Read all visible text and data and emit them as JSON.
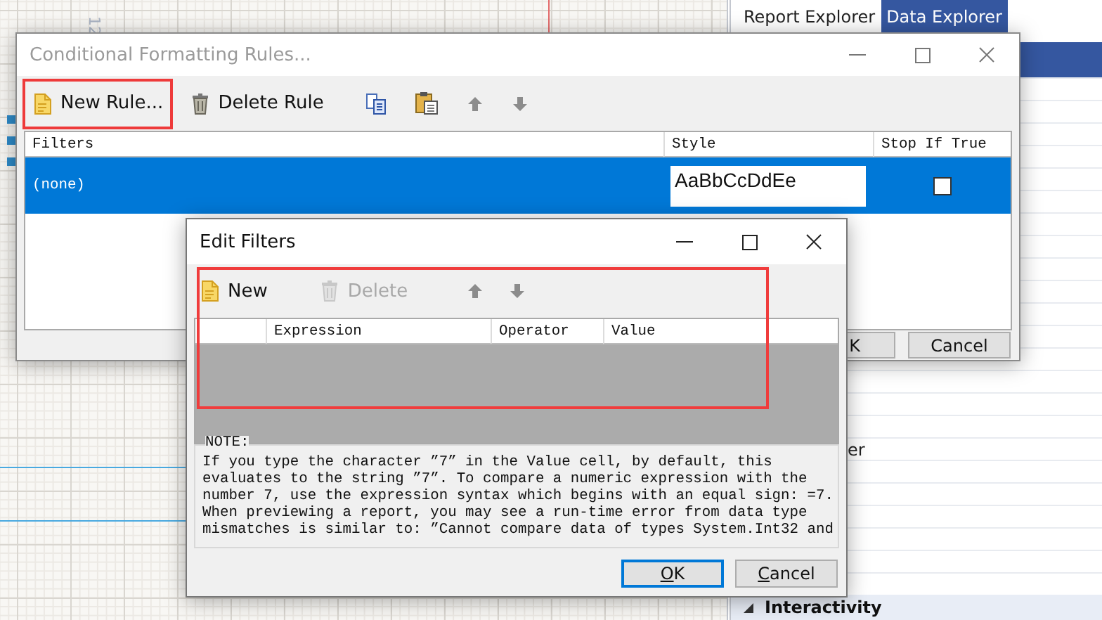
{
  "canvas": {
    "ruler_label": "12"
  },
  "explorer": {
    "tabs": [
      {
        "label": "Report Explorer",
        "selected": false
      },
      {
        "label": "Data Explorer",
        "selected": true
      }
    ],
    "partial_label": "er",
    "section": {
      "label": "Interactivity"
    }
  },
  "rules_dialog": {
    "title": "Conditional Formatting Rules...",
    "active": false,
    "toolbar": [
      {
        "kind": "new",
        "label": "New Rule...",
        "highlighted": true
      },
      {
        "kind": "delete",
        "label": "Delete Rule",
        "highlighted": false
      },
      {
        "kind": "copy",
        "highlighted": false
      },
      {
        "kind": "paste",
        "highlighted": false
      },
      {
        "kind": "up",
        "highlighted": false
      },
      {
        "kind": "down",
        "highlighted": false
      }
    ],
    "columns": [
      "Filters",
      "Style",
      "Stop If True"
    ],
    "rows": [
      {
        "filters": "(none)",
        "style": "AaBbCcDdEe",
        "stop_if_true": false,
        "selected": true
      }
    ],
    "buttons": [
      {
        "label": "K",
        "focused": false
      },
      {
        "label": "Cancel",
        "focused": false
      }
    ]
  },
  "filters_dialog": {
    "title": "Edit Filters",
    "active": true,
    "highlight": true,
    "toolbar": [
      {
        "kind": "new",
        "label": "New",
        "disabled": false
      },
      {
        "kind": "delete",
        "label": "Delete",
        "disabled": true
      },
      {
        "kind": "up",
        "disabled": false
      },
      {
        "kind": "down",
        "disabled": false
      }
    ],
    "columns": [
      "Expression",
      "Operator",
      "Value"
    ],
    "note_label": "NOTE:",
    "note_text": "If you type the character ”7” in the Value cell, by default, this\nevaluates to the string ”7”. To compare a numeric expression with the\nnumber 7, use the expression syntax which begins with an equal sign: =7.\nWhen previewing a report, you may see a run-time error from data type\nmismatches is similar to: ”Cannot compare data of types System.Int32 and",
    "buttons": [
      {
        "label": "OK",
        "focused": true
      },
      {
        "label": "Cancel",
        "focused": false
      }
    ]
  }
}
